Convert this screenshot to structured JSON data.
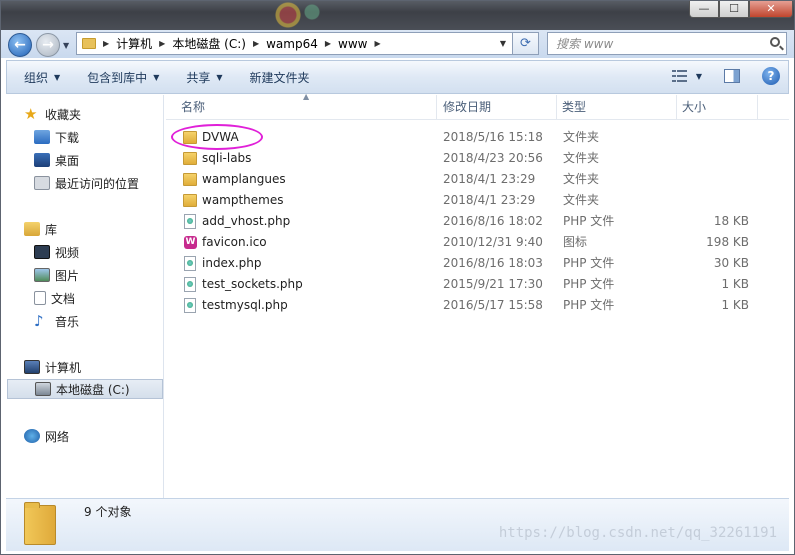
{
  "window": {
    "minimize": "—",
    "maximize": "☐",
    "close": "✕"
  },
  "address": {
    "crumbs": [
      "计算机",
      "本地磁盘 (C:)",
      "wamp64",
      "www"
    ],
    "search_placeholder": "搜索 www"
  },
  "toolbar": {
    "organize": "组织",
    "include_library": "包含到库中",
    "share": "共享",
    "new_folder": "新建文件夹"
  },
  "sidebar": {
    "favorites": "收藏夹",
    "downloads": "下载",
    "desktop": "桌面",
    "recent": "最近访问的位置",
    "libraries": "库",
    "videos": "视频",
    "pictures": "图片",
    "documents": "文档",
    "music": "音乐",
    "computer": "计算机",
    "local_disk": "本地磁盘 (C:)",
    "network": "网络"
  },
  "columns": {
    "name": "名称",
    "date": "修改日期",
    "type": "类型",
    "size": "大小"
  },
  "files": [
    {
      "name": "DVWA",
      "date": "2018/5/16 15:18",
      "type": "文件夹",
      "size": "",
      "icon": "folder"
    },
    {
      "name": "sqli-labs",
      "date": "2018/4/23 20:56",
      "type": "文件夹",
      "size": "",
      "icon": "folder"
    },
    {
      "name": "wamplangues",
      "date": "2018/4/1 23:29",
      "type": "文件夹",
      "size": "",
      "icon": "folder"
    },
    {
      "name": "wampthemes",
      "date": "2018/4/1 23:29",
      "type": "文件夹",
      "size": "",
      "icon": "folder"
    },
    {
      "name": "add_vhost.php",
      "date": "2016/8/16 18:02",
      "type": "PHP 文件",
      "size": "18 KB",
      "icon": "php"
    },
    {
      "name": "favicon.ico",
      "date": "2010/12/31 9:40",
      "type": "图标",
      "size": "198 KB",
      "icon": "ico"
    },
    {
      "name": "index.php",
      "date": "2016/8/16 18:03",
      "type": "PHP 文件",
      "size": "30 KB",
      "icon": "php"
    },
    {
      "name": "test_sockets.php",
      "date": "2015/9/21 17:30",
      "type": "PHP 文件",
      "size": "1 KB",
      "icon": "php"
    },
    {
      "name": "testmysql.php",
      "date": "2016/5/17 15:58",
      "type": "PHP 文件",
      "size": "1 KB",
      "icon": "php"
    }
  ],
  "details": {
    "count": "9 个对象"
  },
  "watermark": "https://blog.csdn.net/qq_32261191",
  "colors": {
    "highlight_circle": "#e020d8",
    "toolbar_text": "#1e395b"
  }
}
